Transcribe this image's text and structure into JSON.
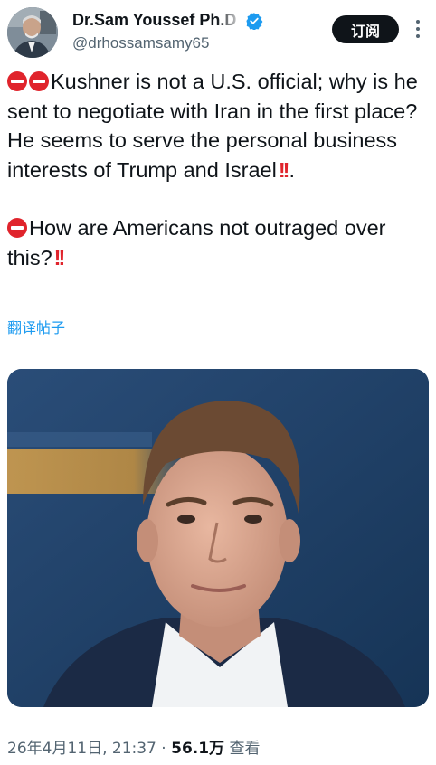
{
  "author": {
    "display_name": "Dr.Sam Youssef Ph.D",
    "handle": "@drhossamsamy65"
  },
  "header": {
    "subscribe_label": "订阅"
  },
  "tweet": {
    "line1": "Kushner is not a U.S. official; why is he sent to negotiate with Iran in the first place? He seems to serve the personal business interests of Trump and Israel",
    "line1_end": ".",
    "line2": "How are Americans not outraged over this?",
    "translate_label": "翻译帖子"
  },
  "meta": {
    "timestamp": "26年4月11日, 21:37",
    "separator": "·",
    "views": "56.1万",
    "views_label": "查看"
  },
  "icons": {
    "stop": "no-entry-icon",
    "exclamation": "double-exclamation-icon",
    "verified": "verified-badge-icon"
  },
  "colors": {
    "verified_blue": "#1d9bf0",
    "emoji_red": "#e0242c",
    "text_primary": "#0f1419",
    "text_secondary": "#536471"
  }
}
